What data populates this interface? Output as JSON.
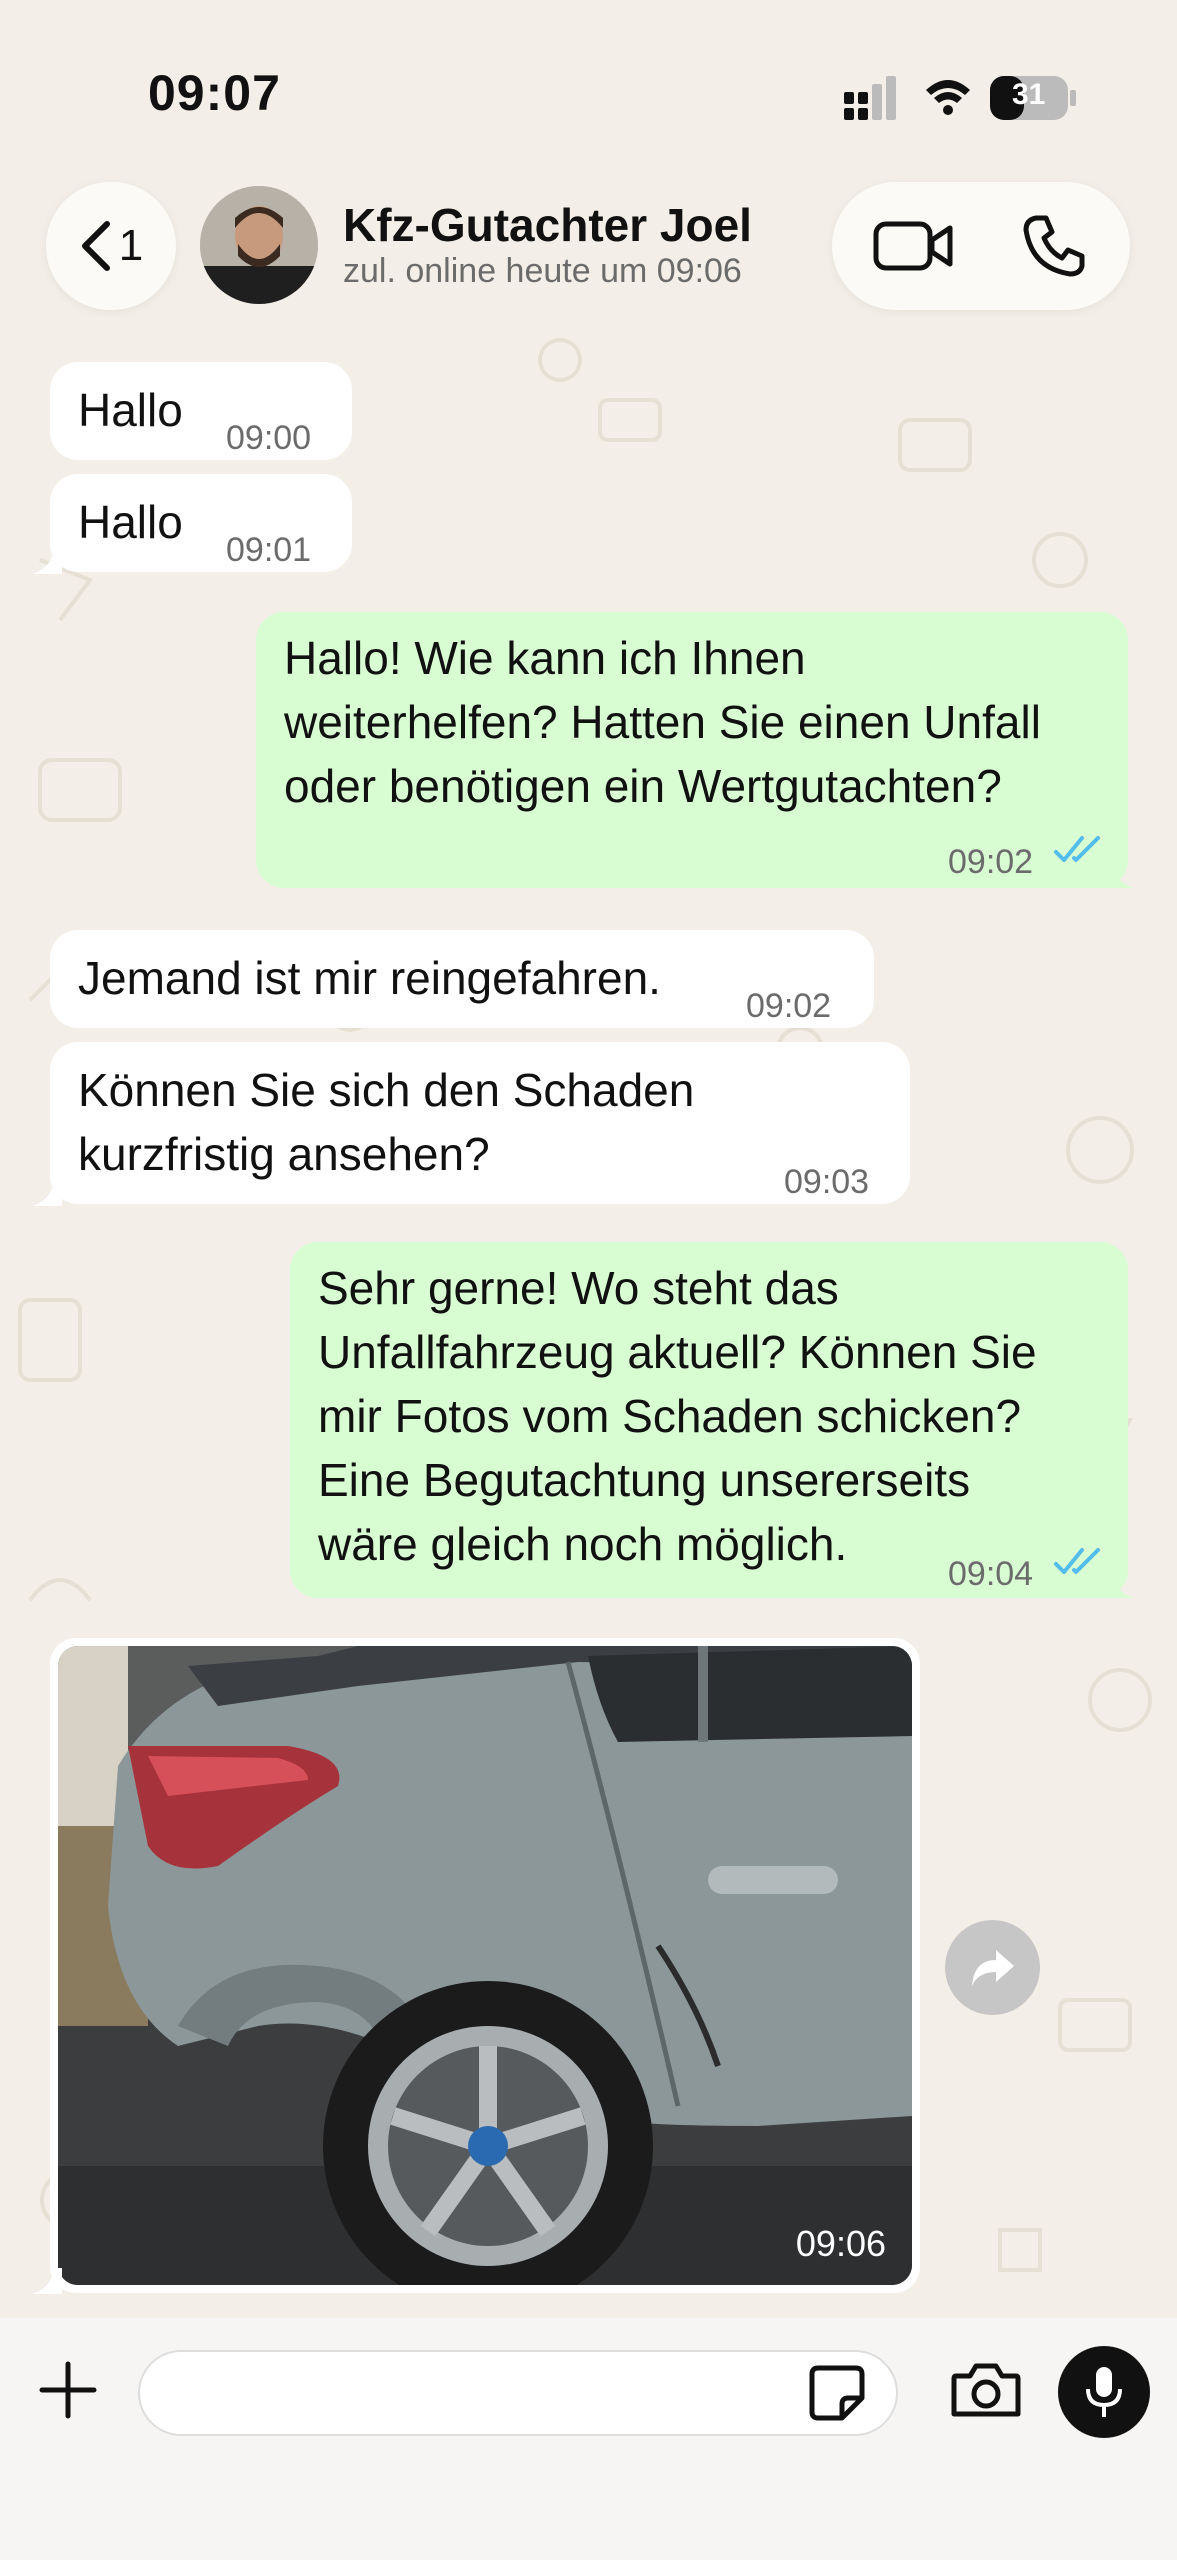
{
  "status_bar": {
    "time": "09:07",
    "battery": "31"
  },
  "header": {
    "back_count": "1",
    "contact_name": "Kfz-Gutachter Joel",
    "contact_status": "zul. online heute um 09:06"
  },
  "messages": [
    {
      "direction": "in",
      "text": "Hallo",
      "time": "09:00"
    },
    {
      "direction": "in",
      "text": "Hallo",
      "time": "09:01"
    },
    {
      "direction": "out",
      "lines": [
        "Hallo! Wie kann ich Ihnen",
        "weiterhelfen? Hatten Sie einen Unfall",
        "oder benötigen ein Wertgutachten?"
      ],
      "time": "09:02",
      "read": true
    },
    {
      "direction": "in",
      "text": "Jemand ist mir reingefahren.",
      "time": "09:02"
    },
    {
      "direction": "in",
      "lines": [
        "Können Sie sich den Schaden",
        "kurzfristig ansehen?"
      ],
      "time": "09:03"
    },
    {
      "direction": "out",
      "lines": [
        "Sehr gerne! Wo steht das",
        "Unfallfahrzeug aktuell? Können Sie",
        "mir Fotos vom Schaden schicken?",
        "Eine Begutachtung unsererseits",
        "wäre gleich noch möglich."
      ],
      "time": "09:04",
      "read": true
    },
    {
      "direction": "in",
      "type": "image",
      "time": "09:06"
    }
  ],
  "input": {
    "placeholder": "",
    "value": ""
  },
  "colors": {
    "outgoing": "#d9fdd3",
    "incoming": "#ffffff",
    "read_ticks": "#53bdeb",
    "background": "#f3efe8"
  },
  "icons": [
    "back-chevron-icon",
    "video-call-icon",
    "phone-icon",
    "forward-icon",
    "plus-icon",
    "sticker-icon",
    "camera-icon",
    "microphone-icon"
  ]
}
